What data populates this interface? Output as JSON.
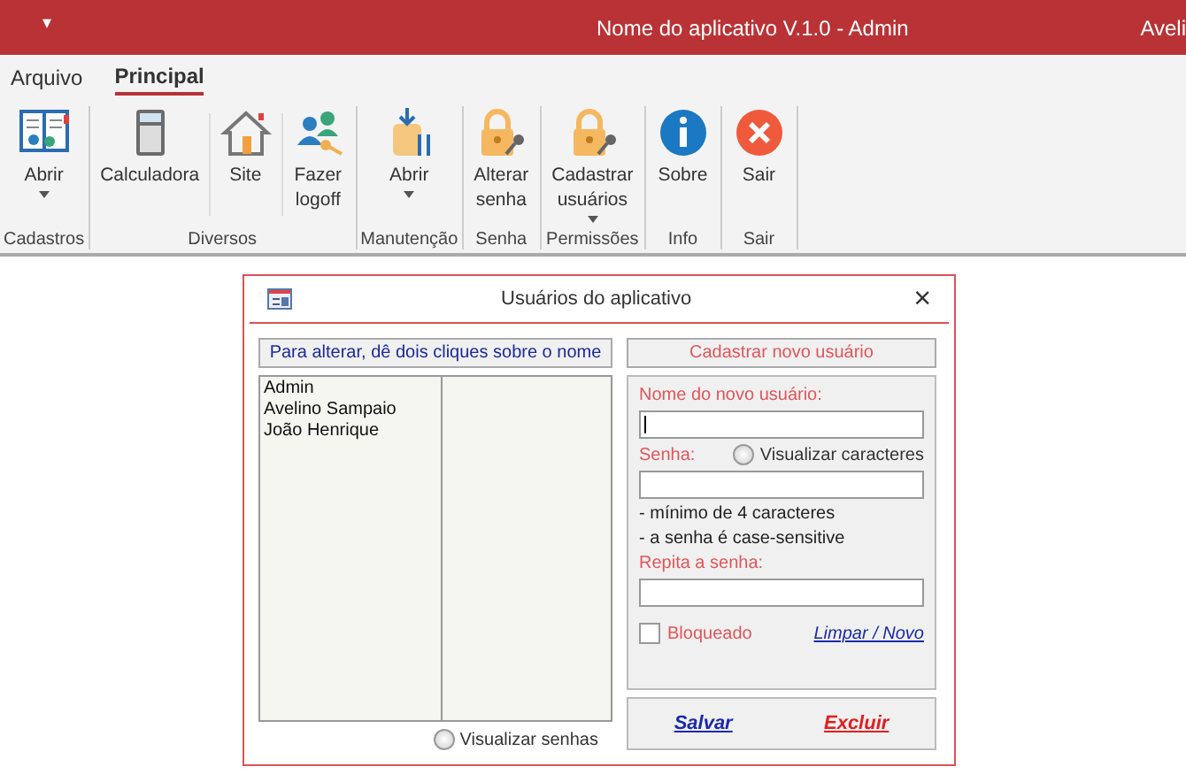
{
  "title_bar": {
    "menu_glyph": "▾",
    "title": "Nome do aplicativo V.1.0 - Admin",
    "user": "Aveli"
  },
  "tabs": [
    {
      "label": "Arquivo",
      "selected": false
    },
    {
      "label": "Principal",
      "selected": true
    }
  ],
  "ribbon": [
    {
      "label": "Cadastros",
      "buttons": [
        {
          "lines": [
            "Abrir"
          ],
          "kind": "book",
          "dropdown": true
        }
      ]
    },
    {
      "label": "Diversos",
      "buttons": [
        {
          "lines": [
            "Calculadora"
          ],
          "kind": "calculator",
          "dropdown": false
        },
        {
          "lines": [
            "Site"
          ],
          "kind": "house",
          "dropdown": false
        },
        {
          "lines": [
            "Fazer",
            "logoff"
          ],
          "kind": "users",
          "dropdown": false
        }
      ]
    },
    {
      "label": "Manutenção",
      "buttons": [
        {
          "lines": [
            "Abrir"
          ],
          "kind": "tools",
          "dropdown": true
        }
      ]
    },
    {
      "label": "Senha",
      "buttons": [
        {
          "lines": [
            "Alterar",
            "senha"
          ],
          "kind": "lock",
          "dropdown": false
        }
      ]
    },
    {
      "label": "Permissões",
      "buttons": [
        {
          "lines": [
            "Cadastrar",
            "usuários"
          ],
          "kind": "lock",
          "dropdown": true
        }
      ]
    },
    {
      "label": "Info",
      "buttons": [
        {
          "lines": [
            "Sobre"
          ],
          "kind": "info",
          "dropdown": false
        }
      ]
    },
    {
      "label": "Sair",
      "buttons": [
        {
          "lines": [
            "Sair"
          ],
          "kind": "exit",
          "dropdown": false
        }
      ]
    }
  ],
  "dialog": {
    "title": "Usuários do aplicativo",
    "close": "×",
    "list_header": "Para alterar, dê dois cliques sobre o nome",
    "users": [
      "Admin",
      "Avelino Sampaio",
      "João Henrique"
    ],
    "show_passwords": {
      "label": "Visualizar senhas",
      "checked": false
    },
    "form_header": "Cadastrar novo usuário",
    "name_label": "Nome do novo usuário:",
    "password_label": "Senha:",
    "show_chars": {
      "label": "Visualizar caracteres",
      "checked": false
    },
    "hints": [
      "- mínimo de 4 caracteres",
      "- a senha é case-sensitive"
    ],
    "repeat_label": "Repita a senha:",
    "blocked": {
      "label": "Bloqueado",
      "checked": false
    },
    "clear_link": "Limpar / Novo",
    "save_link": "Salvar",
    "delete_link": "Excluir"
  }
}
